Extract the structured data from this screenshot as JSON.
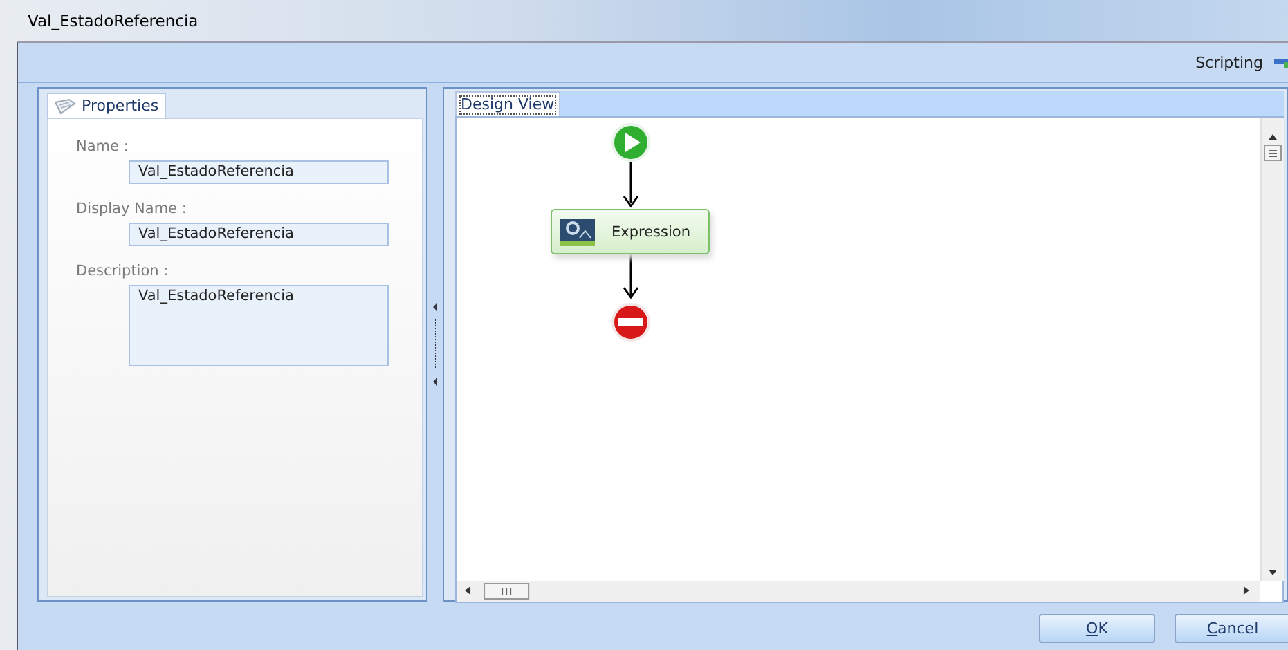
{
  "window": {
    "title": "Val_EstadoReferencia"
  },
  "toolbar": {
    "label": "Scripting"
  },
  "properties_panel": {
    "tab": {
      "label": "Properties",
      "selected": true
    },
    "fields": [
      {
        "kind": "line",
        "label": "Name :",
        "value": "Val_EstadoReferencia"
      },
      {
        "kind": "line",
        "label": "Display Name :",
        "value": "Val_EstadoReferencia"
      },
      {
        "kind": "area",
        "label": "Description :",
        "value": "Val_EstadoReferencia"
      }
    ]
  },
  "design_view": {
    "tab": {
      "label": "Design View",
      "selected": true
    },
    "nodes": [
      {
        "kind": "start"
      },
      {
        "kind": "activity",
        "label": "Expression"
      },
      {
        "kind": "end"
      }
    ]
  },
  "buttons": [
    {
      "label": "OK"
    },
    {
      "label": "Cancel"
    }
  ]
}
